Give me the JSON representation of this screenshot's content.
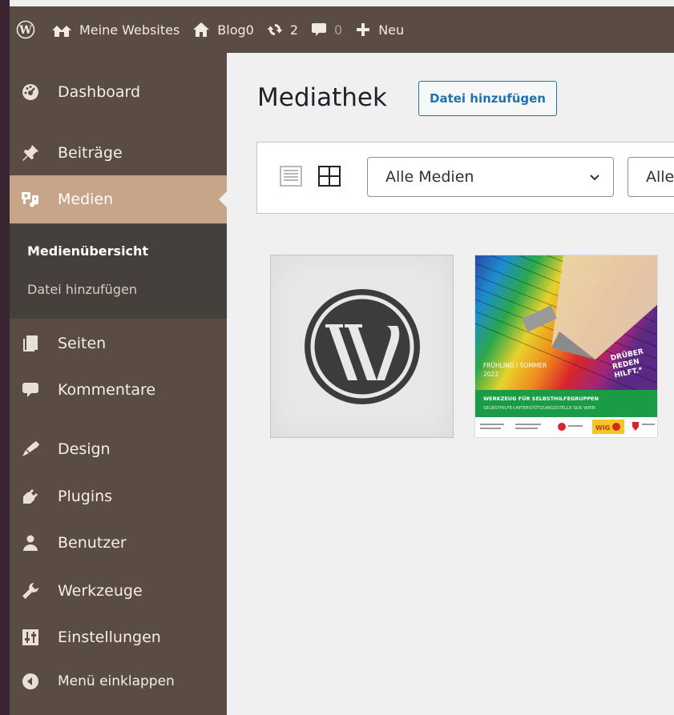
{
  "adminbar": {
    "my_sites": "Meine Websites",
    "site_name": "Blog0",
    "updates_count": "2",
    "comments_count": "0",
    "new_label": "Neu"
  },
  "sidebar": {
    "items": [
      {
        "id": "dashboard",
        "label": "Dashboard",
        "icon": "dashboard-icon"
      },
      {
        "id": "posts",
        "label": "Beiträge",
        "icon": "pin-icon"
      },
      {
        "id": "media",
        "label": "Medien",
        "icon": "media-icon",
        "active": true
      },
      {
        "id": "pages",
        "label": "Seiten",
        "icon": "pages-icon"
      },
      {
        "id": "comments",
        "label": "Kommentare",
        "icon": "comment-icon"
      },
      {
        "id": "appearance",
        "label": "Design",
        "icon": "brush-icon"
      },
      {
        "id": "plugins",
        "label": "Plugins",
        "icon": "plug-icon"
      },
      {
        "id": "users",
        "label": "Benutzer",
        "icon": "user-icon"
      },
      {
        "id": "tools",
        "label": "Werkzeuge",
        "icon": "wrench-icon"
      },
      {
        "id": "settings",
        "label": "Einstellungen",
        "icon": "sliders-icon"
      },
      {
        "id": "collapse",
        "label": "Menü einklappen",
        "icon": "collapse-icon"
      }
    ],
    "submenu": [
      {
        "label": "Medienübersicht",
        "current": true
      },
      {
        "label": "Datei hinzufügen"
      }
    ]
  },
  "main": {
    "title": "Mediathek",
    "add_button": "Datei hinzufügen",
    "filter_type": "Alle Medien",
    "filter_date": "Alle",
    "thumb2": {
      "season": "FRÜHLING / SOMMER",
      "year": "2022",
      "slogan": [
        "DRÜBER",
        "REDEN",
        "HILFT.*"
      ],
      "banner_title": "WERKZEUG FÜR SELBSTHILFEGRUPPEN",
      "banner_sub": "SELBSTHILFE-UNTERSTÜTZUNGSSTELLE SUS WIEN",
      "logo_text": "WIG"
    }
  },
  "colors": {
    "adminbar": "#5a4c42",
    "sidebar": "#5a4c42",
    "submenu": "#46403c",
    "active": "#c7a589",
    "link": "#2271b1"
  }
}
